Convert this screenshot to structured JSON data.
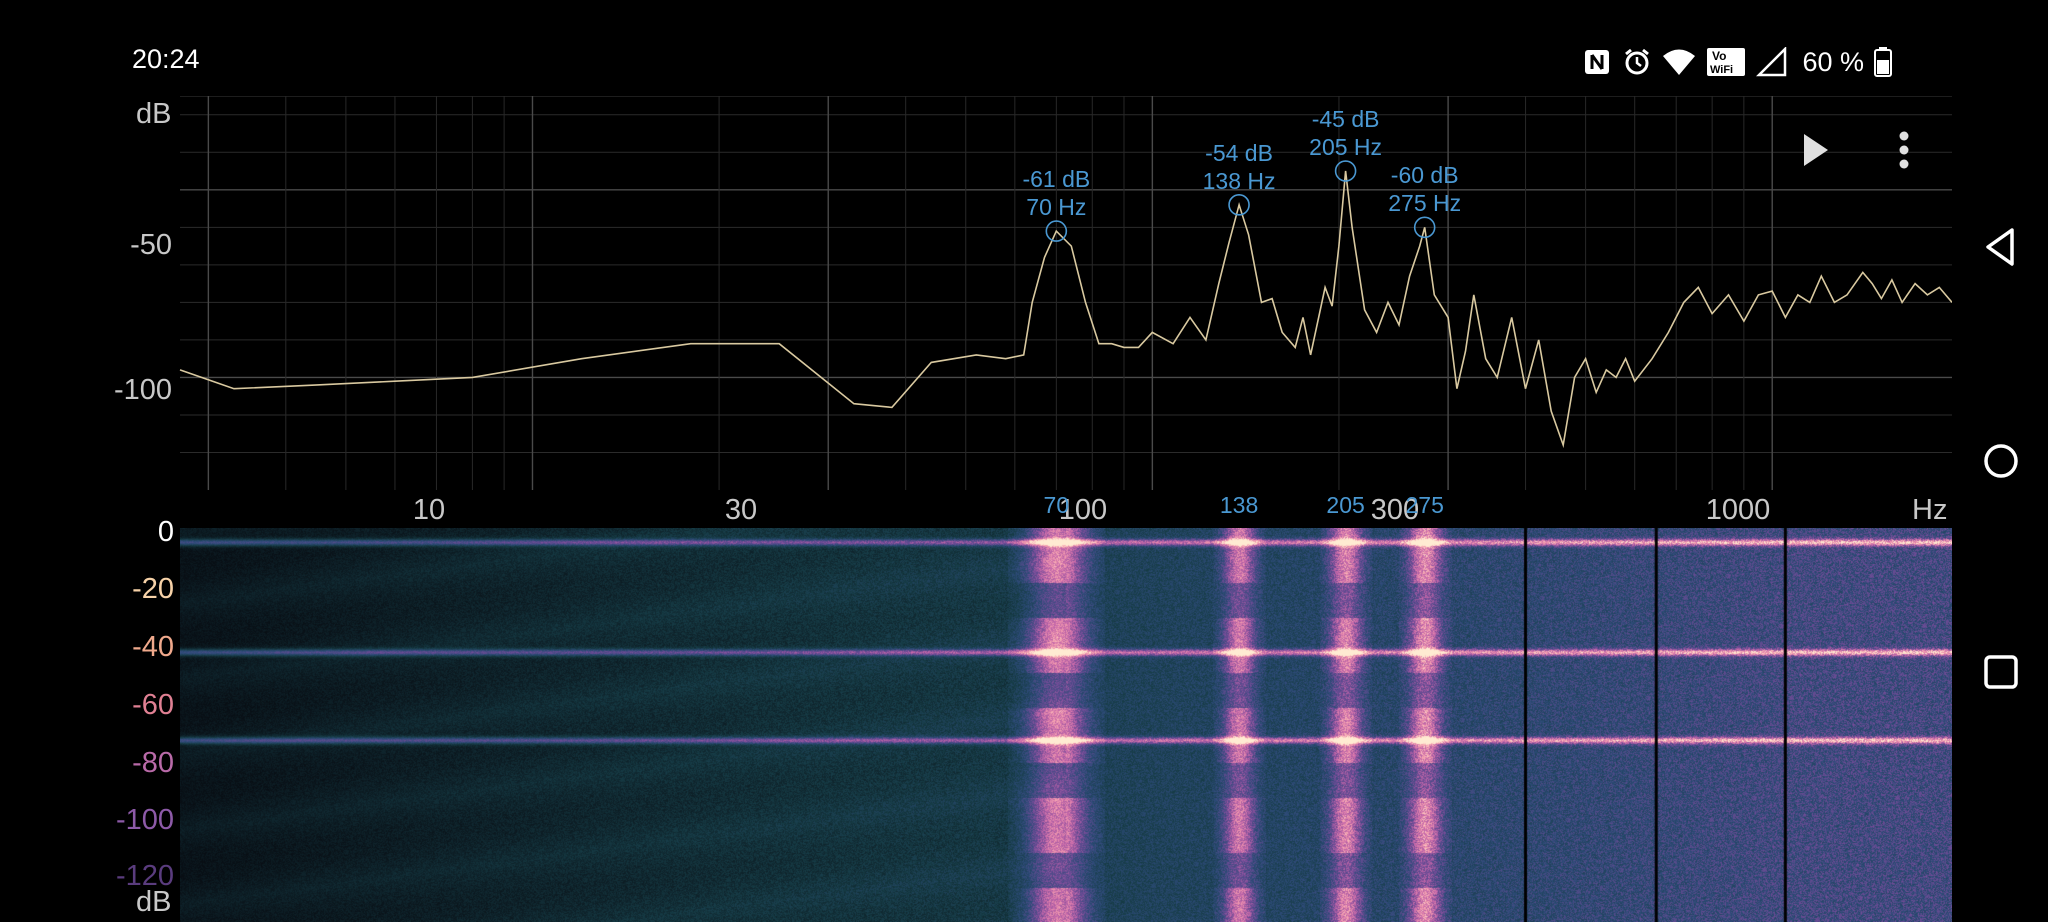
{
  "status_bar": {
    "time": "20:24",
    "battery_percent": "60 %",
    "icons": [
      "nfc-icon",
      "alarm-icon",
      "wifi-icon",
      "vowifi-icon",
      "cell-signal-icon",
      "battery-icon"
    ],
    "volte_top": "Vo",
    "volte_bottom": "WiFi"
  },
  "toolbar": {
    "play_icon": "play-icon",
    "menu_icon": "more-vertical-icon"
  },
  "navigation_bar": {
    "icons": [
      "back-icon",
      "home-icon",
      "recents-icon"
    ]
  },
  "chart_data": [
    {
      "type": "line",
      "x_scale": "log",
      "xlim": [
        2.7,
        1950
      ],
      "ylim": [
        -130,
        -25
      ],
      "ylabel": "dB",
      "xlabel": "Hz",
      "y_ticks": [
        "-50",
        "-100"
      ],
      "x_ticks": [
        "10",
        "30",
        "100",
        "300",
        "1000"
      ],
      "grid": true,
      "line_color": "#d9c9a0",
      "series": [
        {
          "x": [
            2.7,
            3.3,
            4.5,
            6,
            8,
            12,
            18,
            25,
            33,
            38,
            44,
            52,
            58,
            62,
            64,
            67,
            70,
            74,
            78,
            82,
            86,
            90,
            95,
            100,
            108,
            115,
            122,
            128,
            133,
            138,
            143,
            150,
            156,
            162,
            170,
            175,
            180,
            190,
            195,
            200,
            205,
            210,
            220,
            230,
            240,
            250,
            260,
            270,
            275,
            285,
            300,
            310,
            320,
            330,
            345,
            360,
            380,
            400,
            420,
            440,
            460,
            480,
            500,
            520,
            540,
            560,
            580,
            600,
            640,
            680,
            720,
            760,
            800,
            850,
            900,
            950,
            1000,
            1050,
            1100,
            1150,
            1200,
            1260,
            1320,
            1400,
            1450,
            1500,
            1560,
            1620,
            1700,
            1780,
            1860,
            1950
          ],
          "y": [
            -98,
            -103,
            -102,
            -101,
            -100,
            -95,
            -91,
            -91,
            -107,
            -108,
            -96,
            -94,
            -95,
            -94,
            -80,
            -68,
            -61,
            -65,
            -80,
            -91,
            -91,
            -92,
            -92,
            -88,
            -91,
            -84,
            -90,
            -75,
            -64,
            -54,
            -62,
            -80,
            -79,
            -88,
            -92,
            -84,
            -94,
            -76,
            -81,
            -65,
            -45,
            -60,
            -82,
            -88,
            -80,
            -86,
            -73,
            -65,
            -60,
            -78,
            -84,
            -103,
            -93,
            -78,
            -95,
            -100,
            -84,
            -103,
            -90,
            -109,
            -118,
            -100,
            -95,
            -104,
            -98,
            -100,
            -95,
            -101,
            -95,
            -88,
            -80,
            -76,
            -83,
            -78,
            -85,
            -78,
            -77,
            -84,
            -78,
            -80,
            -73,
            -80,
            -78,
            -72,
            -75,
            -79,
            -74,
            -80,
            -75,
            -78,
            -76,
            -80
          ]
        }
      ],
      "peaks": [
        {
          "freq_hz": 70,
          "db": -61,
          "db_label": "-61 dB",
          "hz_label": "70 Hz",
          "axis_label": "70"
        },
        {
          "freq_hz": 138,
          "db": -54,
          "db_label": "-54 dB",
          "hz_label": "138 Hz",
          "axis_label": "138"
        },
        {
          "freq_hz": 205,
          "db": -45,
          "db_label": "-45 dB",
          "hz_label": "205 Hz",
          "axis_label": "205"
        },
        {
          "freq_hz": 275,
          "db": -60,
          "db_label": "-60 dB",
          "hz_label": "275 Hz",
          "axis_label": "275"
        }
      ],
      "unit_x": "Hz",
      "unit_y": "dB"
    },
    {
      "type": "heatmap",
      "description_colormap": "magma",
      "x_scale": "log",
      "ylabel": "dB",
      "color_ticks": [
        "0",
        "-20",
        "-40",
        "-60",
        "-80",
        "-100",
        "-120"
      ],
      "bright_columns_hz": [
        70,
        138,
        205,
        275
      ],
      "vertical_separators_hz": [
        400,
        650,
        1050
      ]
    }
  ]
}
